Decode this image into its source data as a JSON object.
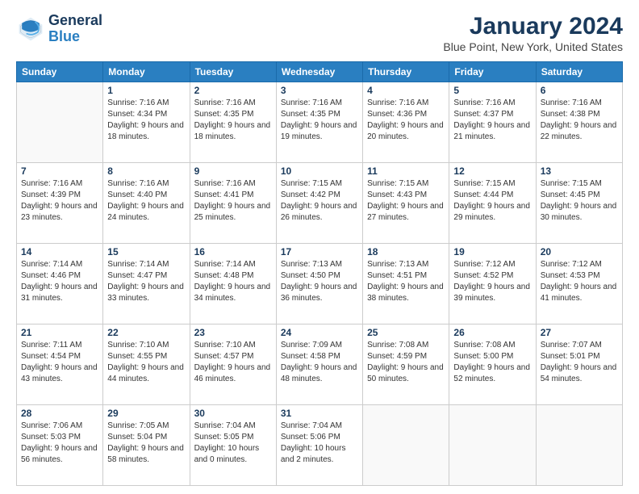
{
  "header": {
    "logo_general": "General",
    "logo_blue": "Blue",
    "title": "January 2024",
    "subtitle": "Blue Point, New York, United States"
  },
  "days": [
    "Sunday",
    "Monday",
    "Tuesday",
    "Wednesday",
    "Thursday",
    "Friday",
    "Saturday"
  ],
  "weeks": [
    [
      {
        "date": "",
        "sunrise": "",
        "sunset": "",
        "daylight": ""
      },
      {
        "date": "1",
        "sunrise": "Sunrise: 7:16 AM",
        "sunset": "Sunset: 4:34 PM",
        "daylight": "Daylight: 9 hours and 18 minutes."
      },
      {
        "date": "2",
        "sunrise": "Sunrise: 7:16 AM",
        "sunset": "Sunset: 4:35 PM",
        "daylight": "Daylight: 9 hours and 18 minutes."
      },
      {
        "date": "3",
        "sunrise": "Sunrise: 7:16 AM",
        "sunset": "Sunset: 4:35 PM",
        "daylight": "Daylight: 9 hours and 19 minutes."
      },
      {
        "date": "4",
        "sunrise": "Sunrise: 7:16 AM",
        "sunset": "Sunset: 4:36 PM",
        "daylight": "Daylight: 9 hours and 20 minutes."
      },
      {
        "date": "5",
        "sunrise": "Sunrise: 7:16 AM",
        "sunset": "Sunset: 4:37 PM",
        "daylight": "Daylight: 9 hours and 21 minutes."
      },
      {
        "date": "6",
        "sunrise": "Sunrise: 7:16 AM",
        "sunset": "Sunset: 4:38 PM",
        "daylight": "Daylight: 9 hours and 22 minutes."
      }
    ],
    [
      {
        "date": "7",
        "sunrise": "Sunrise: 7:16 AM",
        "sunset": "Sunset: 4:39 PM",
        "daylight": "Daylight: 9 hours and 23 minutes."
      },
      {
        "date": "8",
        "sunrise": "Sunrise: 7:16 AM",
        "sunset": "Sunset: 4:40 PM",
        "daylight": "Daylight: 9 hours and 24 minutes."
      },
      {
        "date": "9",
        "sunrise": "Sunrise: 7:16 AM",
        "sunset": "Sunset: 4:41 PM",
        "daylight": "Daylight: 9 hours and 25 minutes."
      },
      {
        "date": "10",
        "sunrise": "Sunrise: 7:15 AM",
        "sunset": "Sunset: 4:42 PM",
        "daylight": "Daylight: 9 hours and 26 minutes."
      },
      {
        "date": "11",
        "sunrise": "Sunrise: 7:15 AM",
        "sunset": "Sunset: 4:43 PM",
        "daylight": "Daylight: 9 hours and 27 minutes."
      },
      {
        "date": "12",
        "sunrise": "Sunrise: 7:15 AM",
        "sunset": "Sunset: 4:44 PM",
        "daylight": "Daylight: 9 hours and 29 minutes."
      },
      {
        "date": "13",
        "sunrise": "Sunrise: 7:15 AM",
        "sunset": "Sunset: 4:45 PM",
        "daylight": "Daylight: 9 hours and 30 minutes."
      }
    ],
    [
      {
        "date": "14",
        "sunrise": "Sunrise: 7:14 AM",
        "sunset": "Sunset: 4:46 PM",
        "daylight": "Daylight: 9 hours and 31 minutes."
      },
      {
        "date": "15",
        "sunrise": "Sunrise: 7:14 AM",
        "sunset": "Sunset: 4:47 PM",
        "daylight": "Daylight: 9 hours and 33 minutes."
      },
      {
        "date": "16",
        "sunrise": "Sunrise: 7:14 AM",
        "sunset": "Sunset: 4:48 PM",
        "daylight": "Daylight: 9 hours and 34 minutes."
      },
      {
        "date": "17",
        "sunrise": "Sunrise: 7:13 AM",
        "sunset": "Sunset: 4:50 PM",
        "daylight": "Daylight: 9 hours and 36 minutes."
      },
      {
        "date": "18",
        "sunrise": "Sunrise: 7:13 AM",
        "sunset": "Sunset: 4:51 PM",
        "daylight": "Daylight: 9 hours and 38 minutes."
      },
      {
        "date": "19",
        "sunrise": "Sunrise: 7:12 AM",
        "sunset": "Sunset: 4:52 PM",
        "daylight": "Daylight: 9 hours and 39 minutes."
      },
      {
        "date": "20",
        "sunrise": "Sunrise: 7:12 AM",
        "sunset": "Sunset: 4:53 PM",
        "daylight": "Daylight: 9 hours and 41 minutes."
      }
    ],
    [
      {
        "date": "21",
        "sunrise": "Sunrise: 7:11 AM",
        "sunset": "Sunset: 4:54 PM",
        "daylight": "Daylight: 9 hours and 43 minutes."
      },
      {
        "date": "22",
        "sunrise": "Sunrise: 7:10 AM",
        "sunset": "Sunset: 4:55 PM",
        "daylight": "Daylight: 9 hours and 44 minutes."
      },
      {
        "date": "23",
        "sunrise": "Sunrise: 7:10 AM",
        "sunset": "Sunset: 4:57 PM",
        "daylight": "Daylight: 9 hours and 46 minutes."
      },
      {
        "date": "24",
        "sunrise": "Sunrise: 7:09 AM",
        "sunset": "Sunset: 4:58 PM",
        "daylight": "Daylight: 9 hours and 48 minutes."
      },
      {
        "date": "25",
        "sunrise": "Sunrise: 7:08 AM",
        "sunset": "Sunset: 4:59 PM",
        "daylight": "Daylight: 9 hours and 50 minutes."
      },
      {
        "date": "26",
        "sunrise": "Sunrise: 7:08 AM",
        "sunset": "Sunset: 5:00 PM",
        "daylight": "Daylight: 9 hours and 52 minutes."
      },
      {
        "date": "27",
        "sunrise": "Sunrise: 7:07 AM",
        "sunset": "Sunset: 5:01 PM",
        "daylight": "Daylight: 9 hours and 54 minutes."
      }
    ],
    [
      {
        "date": "28",
        "sunrise": "Sunrise: 7:06 AM",
        "sunset": "Sunset: 5:03 PM",
        "daylight": "Daylight: 9 hours and 56 minutes."
      },
      {
        "date": "29",
        "sunrise": "Sunrise: 7:05 AM",
        "sunset": "Sunset: 5:04 PM",
        "daylight": "Daylight: 9 hours and 58 minutes."
      },
      {
        "date": "30",
        "sunrise": "Sunrise: 7:04 AM",
        "sunset": "Sunset: 5:05 PM",
        "daylight": "Daylight: 10 hours and 0 minutes."
      },
      {
        "date": "31",
        "sunrise": "Sunrise: 7:04 AM",
        "sunset": "Sunset: 5:06 PM",
        "daylight": "Daylight: 10 hours and 2 minutes."
      },
      {
        "date": "",
        "sunrise": "",
        "sunset": "",
        "daylight": ""
      },
      {
        "date": "",
        "sunrise": "",
        "sunset": "",
        "daylight": ""
      },
      {
        "date": "",
        "sunrise": "",
        "sunset": "",
        "daylight": ""
      }
    ]
  ]
}
